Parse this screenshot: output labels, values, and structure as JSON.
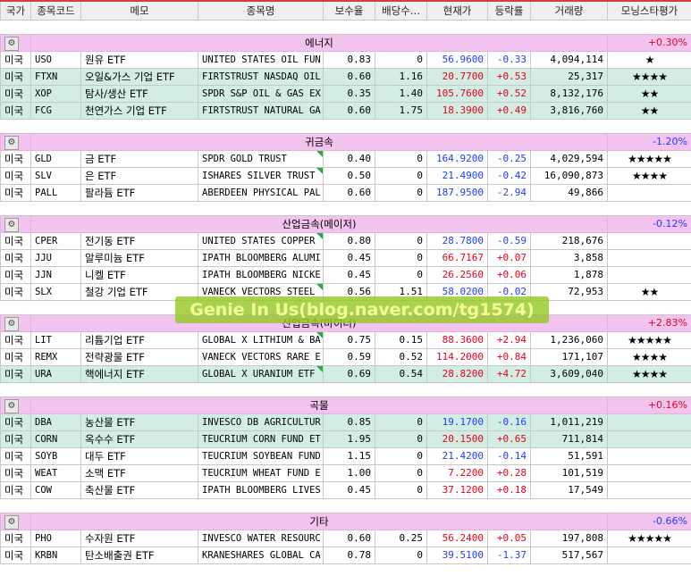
{
  "headers": [
    "국가",
    "종목코드",
    "메모",
    "종목명",
    "보수율",
    "배당수...",
    "현재가",
    "등락률",
    "거래량",
    "모닝스타평가"
  ],
  "sections": [
    {
      "title": "에너지",
      "change": "+0.30%",
      "dir": "pos",
      "rows": [
        {
          "country": "미국",
          "code": "USO",
          "memo": "원유 ETF",
          "name": "UNITED STATES OIL FUN",
          "fee": "0.83",
          "div": "0",
          "price": "56.9600",
          "pc": "blue",
          "rate": "-0.33",
          "vol": "4,094,114",
          "stars": "★",
          "hl": false,
          "flag": false
        },
        {
          "country": "미국",
          "code": "FTXN",
          "memo": "오일&가스 기업 ETF",
          "name": "FIRTSTRUST NASDAQ OIL",
          "fee": "0.60",
          "div": "1.16",
          "price": "20.7700",
          "pc": "red",
          "rate": "+0.53",
          "vol": "25,317",
          "stars": "★★★★",
          "hl": true,
          "flag": false
        },
        {
          "country": "미국",
          "code": "XOP",
          "memo": "탐사/생산 ETF",
          "name": "SPDR S&P OIL & GAS EX",
          "fee": "0.35",
          "div": "1.40",
          "price": "105.7600",
          "pc": "red",
          "rate": "+0.52",
          "vol": "8,132,176",
          "stars": "★★",
          "hl": true,
          "flag": false
        },
        {
          "country": "미국",
          "code": "FCG",
          "memo": "천연가스 기업 ETF",
          "name": "FIRTSTRUST NATURAL GA",
          "fee": "0.60",
          "div": "1.75",
          "price": "18.3900",
          "pc": "red",
          "rate": "+0.49",
          "vol": "3,816,760",
          "stars": "★★",
          "hl": true,
          "flag": false
        }
      ]
    },
    {
      "title": "귀금속",
      "change": "-1.20%",
      "dir": "neg",
      "rows": [
        {
          "country": "미국",
          "code": "GLD",
          "memo": "금 ETF",
          "name": "SPDR GOLD TRUST",
          "fee": "0.40",
          "div": "0",
          "price": "164.9200",
          "pc": "blue",
          "rate": "-0.25",
          "vol": "4,029,594",
          "stars": "★★★★★",
          "hl": false,
          "flag": true
        },
        {
          "country": "미국",
          "code": "SLV",
          "memo": "은 ETF",
          "name": "ISHARES SILVER TRUST",
          "fee": "0.50",
          "div": "0",
          "price": "21.4900",
          "pc": "blue",
          "rate": "-0.42",
          "vol": "16,090,873",
          "stars": "★★★★",
          "hl": false,
          "flag": true
        },
        {
          "country": "미국",
          "code": "PALL",
          "memo": "팔라듐 ETF",
          "name": "ABERDEEN PHYSICAL PAL",
          "fee": "0.60",
          "div": "0",
          "price": "187.9500",
          "pc": "blue",
          "rate": "-2.94",
          "vol": "49,866",
          "stars": "",
          "hl": false,
          "flag": false
        }
      ]
    },
    {
      "title": "산업금속(메이저)",
      "change": "-0.12%",
      "dir": "neg",
      "rows": [
        {
          "country": "미국",
          "code": "CPER",
          "memo": "전기동 ETF",
          "name": "UNITED STATES COPPER",
          "fee": "0.80",
          "div": "0",
          "price": "28.7800",
          "pc": "blue",
          "rate": "-0.59",
          "vol": "218,676",
          "stars": "",
          "hl": false,
          "flag": true
        },
        {
          "country": "미국",
          "code": "JJU",
          "memo": "알루미늄 ETF",
          "name": "IPATH BLOOMBERG ALUMI",
          "fee": "0.45",
          "div": "0",
          "price": "66.7167",
          "pc": "red",
          "rate": "+0.07",
          "vol": "3,858",
          "stars": "",
          "hl": false,
          "flag": false
        },
        {
          "country": "미국",
          "code": "JJN",
          "memo": "니켈 ETF",
          "name": "IPATH BLOOMBERG NICKE",
          "fee": "0.45",
          "div": "0",
          "price": "26.2560",
          "pc": "red",
          "rate": "+0.06",
          "vol": "1,878",
          "stars": "",
          "hl": false,
          "flag": false
        },
        {
          "country": "미국",
          "code": "SLX",
          "memo": "철강 기업 ETF",
          "name": "VANECK VECTORS STEEL",
          "fee": "0.56",
          "div": "1.51",
          "price": "58.0200",
          "pc": "blue",
          "rate": "-0.02",
          "vol": "72,953",
          "stars": "★★",
          "hl": false,
          "flag": true
        }
      ]
    },
    {
      "title": "산업금속(마이너)",
      "change": "+2.83%",
      "dir": "pos",
      "rows": [
        {
          "country": "미국",
          "code": "LIT",
          "memo": "리튬기업 ETF",
          "name": "GLOBAL X LITHIUM & BA",
          "fee": "0.75",
          "div": "0.15",
          "price": "88.3600",
          "pc": "red",
          "rate": "+2.94",
          "vol": "1,236,060",
          "stars": "★★★★★",
          "hl": false,
          "flag": true
        },
        {
          "country": "미국",
          "code": "REMX",
          "memo": "전략광물 ETF",
          "name": "VANECK VECTORS RARE E",
          "fee": "0.59",
          "div": "0.52",
          "price": "114.2000",
          "pc": "red",
          "rate": "+0.84",
          "vol": "171,107",
          "stars": "★★★★",
          "hl": false,
          "flag": false
        },
        {
          "country": "미국",
          "code": "URA",
          "memo": "핵에너지 ETF",
          "name": "GLOBAL X URANIUM ETF",
          "fee": "0.69",
          "div": "0.54",
          "price": "28.8200",
          "pc": "red",
          "rate": "+4.72",
          "vol": "3,609,040",
          "stars": "★★★★",
          "hl": true,
          "flag": true
        }
      ]
    },
    {
      "title": "곡물",
      "change": "+0.16%",
      "dir": "pos",
      "rows": [
        {
          "country": "미국",
          "code": "DBA",
          "memo": "농산물 ETF",
          "name": "INVESCO DB AGRICULTUR",
          "fee": "0.85",
          "div": "0",
          "price": "19.1700",
          "pc": "blue",
          "rate": "-0.16",
          "vol": "1,011,219",
          "stars": "",
          "hl": true,
          "flag": false
        },
        {
          "country": "미국",
          "code": "CORN",
          "memo": "옥수수 ETF",
          "name": "TEUCRIUM CORN FUND ET",
          "fee": "1.95",
          "div": "0",
          "price": "20.1500",
          "pc": "red",
          "rate": "+0.65",
          "vol": "711,814",
          "stars": "",
          "hl": true,
          "flag": false
        },
        {
          "country": "미국",
          "code": "SOYB",
          "memo": "대두 ETF",
          "name": "TEUCRIUM SOYBEAN FUND",
          "fee": "1.15",
          "div": "0",
          "price": "21.4200",
          "pc": "blue",
          "rate": "-0.14",
          "vol": "51,591",
          "stars": "",
          "hl": false,
          "flag": false
        },
        {
          "country": "미국",
          "code": "WEAT",
          "memo": "소맥 ETF",
          "name": "TEUCRIUM WHEAT FUND E",
          "fee": "1.00",
          "div": "0",
          "price": "7.2200",
          "pc": "red",
          "rate": "+0.28",
          "vol": "101,519",
          "stars": "",
          "hl": false,
          "flag": false
        },
        {
          "country": "미국",
          "code": "COW",
          "memo": "축산물 ETF",
          "name": "IPATH BLOOMBERG LIVES",
          "fee": "0.45",
          "div": "0",
          "price": "37.1200",
          "pc": "red",
          "rate": "+0.18",
          "vol": "17,549",
          "stars": "",
          "hl": false,
          "flag": false
        }
      ]
    },
    {
      "title": "기타",
      "change": "-0.66%",
      "dir": "neg",
      "rows": [
        {
          "country": "미국",
          "code": "PHO",
          "memo": "수자원 ETF",
          "name": "INVESCO WATER RESOURC",
          "fee": "0.60",
          "div": "0.25",
          "price": "56.2400",
          "pc": "red",
          "rate": "+0.05",
          "vol": "197,808",
          "stars": "★★★★★",
          "hl": false,
          "flag": false
        },
        {
          "country": "미국",
          "code": "KRBN",
          "memo": "탄소배출권 ETF",
          "name": "KRANESHARES GLOBAL CA",
          "fee": "0.78",
          "div": "0",
          "price": "39.5100",
          "pc": "blue",
          "rate": "-1.37",
          "vol": "517,567",
          "stars": "",
          "hl": false,
          "flag": false
        }
      ]
    }
  ],
  "watermark": "Genie In Us(blog.naver.com/tg1574)"
}
